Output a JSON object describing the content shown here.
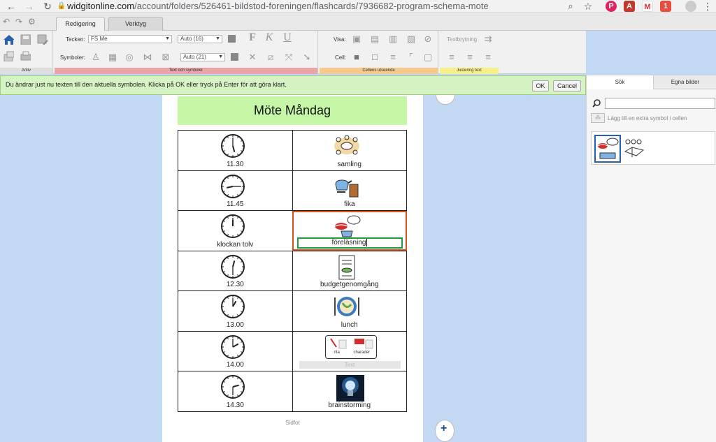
{
  "browser": {
    "url_host": "widgitonline.com",
    "url_path": "/account/folders/526461-bildstod-foreningen/flashcards/7936682-program-schema-mote",
    "ext_badge": "1"
  },
  "ribbon": {
    "tabs": [
      "Redigering",
      "Verktyg"
    ],
    "font_label": "Tecken:",
    "font_value": "FS Me",
    "font_size": "Auto (16)",
    "symbols_label": "Symboler:",
    "symbol_size": "Auto (21)",
    "view_label": "Visa:",
    "cell_label": "Cell:",
    "textwrap_label": "Textbrytning",
    "groups": [
      "Arkiv",
      "Text och symboler",
      "Cellens utseende",
      "Justering text"
    ]
  },
  "notice": {
    "text": "Du ändrar just nu texten till den aktuella symbolen. Klicka på OK eller tryck på Enter för att göra klart.",
    "ok": "OK",
    "cancel": "Cancel"
  },
  "side": {
    "tabs": [
      "Sök",
      "Egna bilder"
    ],
    "add_symbol": "Lägg till en extra symbol i cellen",
    "search_value": ""
  },
  "document": {
    "title": "Möte Måndag",
    "rows": [
      {
        "time": "11.30",
        "activity": "samling"
      },
      {
        "time": "11.45",
        "activity": "fika"
      },
      {
        "time": "klockan tolv",
        "activity": "föreläsning"
      },
      {
        "time": "12.30",
        "activity": "budgetgenomgång"
      },
      {
        "time": "13.00",
        "activity": "lunch"
      },
      {
        "time": "14.00",
        "activity": "Text"
      },
      {
        "time": "14.30",
        "activity": "brainstorming"
      }
    ],
    "sub_labels": [
      "rita",
      "charader"
    ],
    "footer": "Sidfot"
  },
  "colors": {
    "title_bg": "#c6f7a6",
    "selection": "#d94f1c",
    "edit_box": "#1f9d3a",
    "background": "#c3d8f2"
  }
}
